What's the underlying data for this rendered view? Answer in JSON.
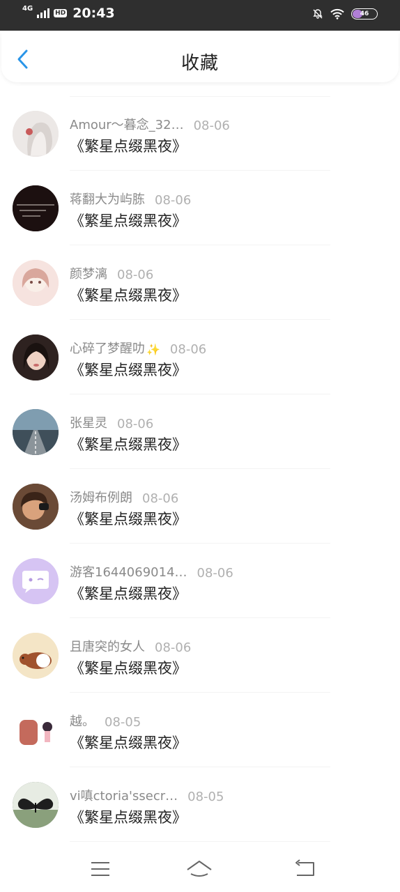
{
  "status_bar": {
    "network": "4G",
    "hd": "HD",
    "time": "20:43",
    "battery": "46",
    "icons": [
      "signal-icon",
      "mute-bell-icon",
      "wifi-icon",
      "battery-icon"
    ]
  },
  "header": {
    "title": "收藏",
    "back_icon": "back-chevron-icon"
  },
  "list": {
    "items": [
      {
        "name": "Amour～暮念_32…",
        "date": "08-06",
        "title": "《繁星点缀黑夜》",
        "avatar": "girl-portrait",
        "avatar_bg": "#e9e4e2"
      },
      {
        "name": "蒋翻大为屿胨",
        "date": "08-06",
        "title": "《繁星点缀黑夜》",
        "avatar": "text-on-black",
        "avatar_bg": "#1a0f0f"
      },
      {
        "name": "颜梦漓",
        "date": "08-06",
        "title": "《繁星点缀黑夜》",
        "avatar": "anime-girl",
        "avatar_bg": "#f3d6d2"
      },
      {
        "name": "心碎了梦醒叻",
        "date": "08-06",
        "title": "《繁星点缀黑夜》",
        "avatar": "girl-photo",
        "avatar_bg": "#3a2a28",
        "has_sparkle": true,
        "sparkle": "✨"
      },
      {
        "name": "张星灵",
        "date": "08-06",
        "title": "《繁星点缀黑夜》",
        "avatar": "road-landscape",
        "avatar_bg": "#5d7e93"
      },
      {
        "name": "汤姆布例朗",
        "date": "08-06",
        "title": "《繁星点缀黑夜》",
        "avatar": "boy-photo",
        "avatar_bg": "#5b3b2a"
      },
      {
        "name": "游客1644069014…",
        "date": "08-06",
        "title": "《繁星点缀黑夜》",
        "avatar": "chat-bubble",
        "avatar_bg": "#d5c3f2"
      },
      {
        "name": "且唐突的女人",
        "date": "08-06",
        "title": "《繁星点缀黑夜》",
        "avatar": "guinea-pig",
        "avatar_bg": "#f5e6c8"
      },
      {
        "name": "越。",
        "date": "08-05",
        "title": "《繁星点缀黑夜》",
        "avatar": "girl-illustration",
        "avatar_bg": "#ffffff"
      },
      {
        "name": "vi嗔ctoria'ssecr…",
        "date": "08-05",
        "title": "《繁星点缀黑夜》",
        "avatar": "butterfly",
        "avatar_bg": "#4b5a4d"
      }
    ]
  },
  "nav_bar": {
    "icons": [
      "menu-icon",
      "home-icon",
      "return-icon"
    ]
  }
}
